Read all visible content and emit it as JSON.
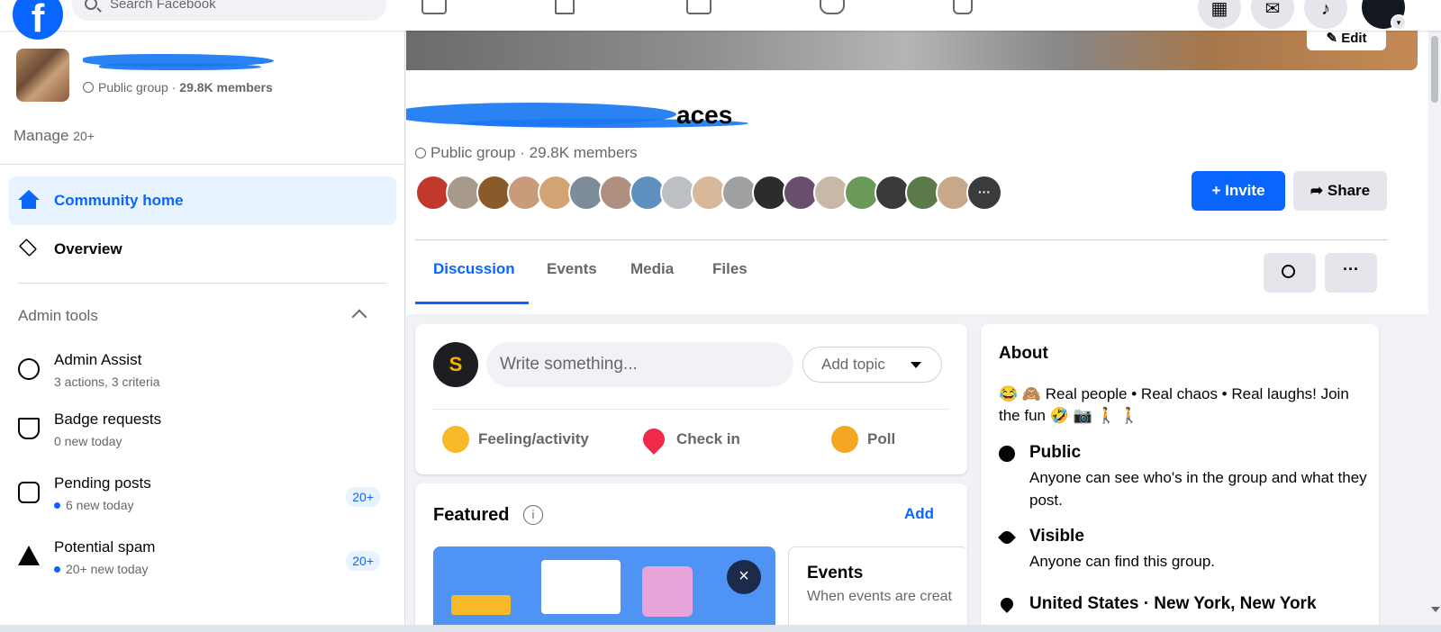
{
  "topbar": {
    "logo": "f",
    "search_placeholder": "Search Facebook",
    "right_icons": [
      "apps-icon",
      "messenger-icon",
      "bell-icon"
    ]
  },
  "sidebar": {
    "group_meta_prefix": "Public group · ",
    "group_members": "29.8K members",
    "manage": "Manage",
    "manage_count": "20+",
    "items": [
      {
        "label": "Community home",
        "icon": "home-icon",
        "active": true
      },
      {
        "label": "Overview",
        "icon": "layers-icon",
        "active": false
      }
    ],
    "admin_tools_label": "Admin tools",
    "tools": [
      {
        "title": "Admin Assist",
        "sub": "3 actions, 3 criteria",
        "badge": ""
      },
      {
        "title": "Badge requests",
        "sub": "0 new today",
        "badge": ""
      },
      {
        "title": "Pending posts",
        "sub": "6 new today",
        "badge": "20+"
      },
      {
        "title": "Potential spam",
        "sub": "20+ new today",
        "badge": "20+"
      }
    ]
  },
  "main": {
    "edit_cover": "Edit",
    "group_title_visible": "aces",
    "group_meta": "Public group · 29.8K members",
    "member_more": "···",
    "invite_label": "+ Invite",
    "share_label": "Share",
    "tabs": [
      "Discussion",
      "Events",
      "Media",
      "Files"
    ],
    "more_label": "···",
    "composer": {
      "placeholder": "Write something...",
      "add_topic": "Add topic",
      "actions": [
        "Feeling/activity",
        "Check in",
        "Poll"
      ],
      "avatar_letter": "S"
    },
    "featured": {
      "title": "Featured",
      "info": "i",
      "add": "Add",
      "close": "×",
      "event_title": "Events",
      "event_desc": "When events are creat"
    },
    "about": {
      "title": "About",
      "description": "😂 🙈 Real people • Real chaos • Real laughs! Join the fun 🤣 📷 🚶 🚶",
      "rows": [
        {
          "title": "Public",
          "text": "Anyone can see who's in the group and what they post.",
          "icon": "globe-icon"
        },
        {
          "title": "Visible",
          "text": "Anyone can find this group.",
          "icon": "eye-icon"
        },
        {
          "title": "United States · New York, New York",
          "text": "",
          "icon": "location-pin-icon"
        }
      ]
    }
  },
  "colors": {
    "brand": "#0866ff",
    "active_bg": "#e7f3ff",
    "page_bg": "#f0f2f5"
  }
}
